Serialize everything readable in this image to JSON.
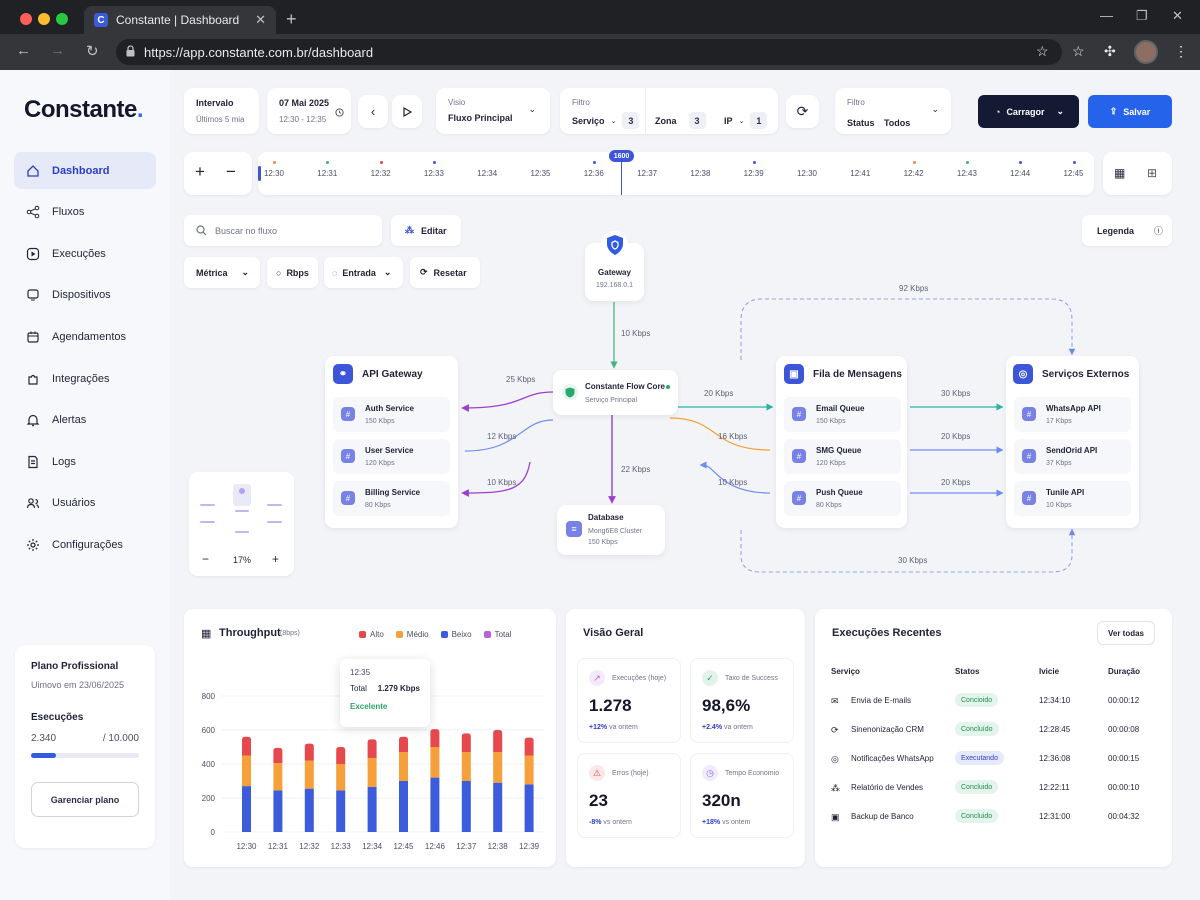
{
  "browser": {
    "tab_title": "Constante | Dashboard",
    "url": "https://app.constante.com.br/dashboard",
    "favicon": "C"
  },
  "brand": {
    "name": "Constante",
    "dot": "."
  },
  "sidebar": {
    "items": [
      {
        "label": "Dashboard",
        "icon": "home-icon"
      },
      {
        "label": "Fluxos",
        "icon": "share-icon"
      },
      {
        "label": "Execuções",
        "icon": "play-circle-icon"
      },
      {
        "label": "Dispositivos",
        "icon": "device-icon"
      },
      {
        "label": "Agendamentos",
        "icon": "calendar-icon"
      },
      {
        "label": "Integrações",
        "icon": "puzzle-icon"
      },
      {
        "label": "Alertas",
        "icon": "bell-icon"
      },
      {
        "label": "Logs",
        "icon": "file-icon"
      },
      {
        "label": "Usuários",
        "icon": "users-icon"
      },
      {
        "label": "Configurações",
        "icon": "gear-icon"
      }
    ]
  },
  "plan": {
    "title": "Plano Profissional",
    "renew": "Uimovo em 23/06/2025",
    "exec_label": "Esecuções",
    "used": "2.340",
    "total": "/ 10.000",
    "progress": 0.234,
    "button": "Garenciar plano"
  },
  "toolbar": {
    "interval_label": "Intervalo",
    "interval_value": "Últimos 5 mia",
    "date": "07 Mai 2025",
    "time_range": "12:30 - 12:35",
    "view_label": "Visio",
    "view_value": "Fluxo Principal",
    "filter_label": "Filtro",
    "servico": "Serviço",
    "servico_count": "3",
    "zona": "Zona",
    "zona_count": "3",
    "ip": "IP",
    "ip_count": "1",
    "filter2_label": "Filtro",
    "status": "Status",
    "status_value": "Todos",
    "load": "Carragor",
    "save": "Salvar"
  },
  "timeline": {
    "labels": [
      "12:30",
      "12:31",
      "12:32",
      "12:33",
      "12:34",
      "12:35",
      "12:36",
      "12:37",
      "12:38",
      "12:39",
      "12:30",
      "12:41",
      "12:42",
      "12:43",
      "12:44",
      "12:45"
    ],
    "marker": "1600",
    "dots": [
      "#f08c4a",
      "#45b46c",
      "#e5484d",
      "#3d56d9",
      "",
      "",
      "#3d56d9",
      "",
      "",
      "#3d56d9",
      "",
      "",
      "#f08c4a",
      "#45b46c",
      "#3d56d9",
      "#3d56d9"
    ]
  },
  "flow_controls": {
    "search_placeholder": "Buscar no fluxo",
    "edit": "Editar",
    "metric": "Métrica",
    "rbps": "Rbps",
    "entrada": "Entrada",
    "reset": "Resetar",
    "legend": "Legenda",
    "zoom": "17%"
  },
  "nodes": {
    "gateway": {
      "title": "Gateway",
      "ip": "192.168.0.1"
    },
    "core": {
      "title": "Constante Flow Core",
      "sub": "Serviço Principal"
    },
    "database": {
      "title": "Database",
      "sub": "Mong6E8 Cluster",
      "rate": "150 Kbps"
    },
    "api": {
      "title": "API Gateway",
      "items": [
        {
          "name": "Auth Service",
          "rate": "150 Kbps"
        },
        {
          "name": "User Service",
          "rate": "120 Kbps"
        },
        {
          "name": "Billing Service",
          "rate": "80 Kbps"
        }
      ]
    },
    "queue": {
      "title": "Fila de Mensagens",
      "items": [
        {
          "name": "Email Queue",
          "rate": "150 Kbps"
        },
        {
          "name": "SMG Queue",
          "rate": "120 Kbps"
        },
        {
          "name": "Push Queue",
          "rate": "80 Kbps"
        }
      ]
    },
    "external": {
      "title": "Serviços Externos",
      "items": [
        {
          "name": "WhatsApp API",
          "rate": "17 Kbps"
        },
        {
          "name": "SendOrid API",
          "rate": "37 Kbps"
        },
        {
          "name": "Tunile API",
          "rate": "10 Kbps"
        }
      ]
    }
  },
  "flow_labels": {
    "gw_core": "10 Kbps",
    "core_api": "25 Kbps",
    "api_core": "12 Kbps",
    "core_billing": "10 Kbps",
    "core_db": "22 Kbps",
    "core_queue": "20 Kbps",
    "core_smg": "16 Kbps",
    "push_back": "10 Kbps",
    "q_ext1": "30 Kbps",
    "q_ext2": "20 Kbps",
    "q_ext3": "20 Kbps",
    "top_loop": "92 Kbps",
    "bottom_loop": "30 Kbps"
  },
  "throughput": {
    "title": "Throughput",
    "unit": "(8bps)",
    "legend": [
      {
        "name": "Alto",
        "color": "#e5484d"
      },
      {
        "name": "Médio",
        "color": "#f5a03a"
      },
      {
        "name": "Beixo",
        "color": "#3d5cdb"
      },
      {
        "name": "Total",
        "color": "#b565d9"
      }
    ],
    "tooltip": {
      "time": "12:35",
      "label": "Total",
      "value": "1.279 Kbps",
      "status": "Excelente"
    }
  },
  "chart_data": {
    "type": "bar",
    "title": "Throughput",
    "categories": [
      "12:30",
      "12:31",
      "12:32",
      "12:33",
      "12:34",
      "12:45",
      "12:46",
      "12:37",
      "12:38",
      "12:39"
    ],
    "yticks": [
      0,
      200,
      400,
      600,
      800
    ],
    "ylim": [
      0,
      800
    ],
    "series": [
      {
        "name": "Beixo",
        "values": [
          270,
          245,
          255,
          245,
          265,
          300,
          320,
          300,
          290,
          280
        ]
      },
      {
        "name": "Médio",
        "values": [
          180,
          160,
          165,
          155,
          170,
          170,
          180,
          170,
          180,
          170
        ]
      },
      {
        "name": "Alto",
        "values": [
          110,
          90,
          100,
          100,
          110,
          90,
          105,
          110,
          130,
          105
        ]
      }
    ]
  },
  "overview": {
    "title": "Visão Geral",
    "cards": [
      {
        "label": "Execuções (hoje)",
        "value": "1.278",
        "delta": "+12%",
        "suffix": "va ontem",
        "color": "#b565d9",
        "icon": "trend-icon"
      },
      {
        "label": "Taxo de Success",
        "value": "98,6%",
        "delta": "+2.4%",
        "suffix": "va ontem",
        "color": "#2aa86b",
        "icon": "check-icon"
      },
      {
        "label": "Erros (hoje)",
        "value": "23",
        "delta": "-8%",
        "suffix": "vs ontem",
        "color": "#e5484d",
        "icon": "warning-icon"
      },
      {
        "label": "Tempo Economio",
        "value": "320n",
        "delta": "+18%",
        "suffix": "vs ontem",
        "color": "#8a6de0",
        "icon": "clock-icon"
      }
    ]
  },
  "recent": {
    "title": "Execuções Recentes",
    "see_all": "Ver todas",
    "headers": [
      "Serviço",
      "Statos",
      "Ivicie",
      "Duração"
    ],
    "rows": [
      {
        "name": "Envia de E-mails",
        "status": "Concioido",
        "start": "12:34:10",
        "dur": "00:00:12",
        "type": "ok"
      },
      {
        "name": "Sinenonização CRM",
        "status": "Concluído",
        "start": "12:28:45",
        "dur": "00:00:08",
        "type": "ok"
      },
      {
        "name": "Notificações WhatsApp",
        "status": "Executando",
        "start": "12:36:08",
        "dur": "00:00:15",
        "type": "run"
      },
      {
        "name": "Relatório de Vendes",
        "status": "Concluido",
        "start": "12:22:11",
        "dur": "00:00:10",
        "type": "ok"
      },
      {
        "name": "Backup de Banco",
        "status": "Concluido",
        "start": "12:31:00",
        "dur": "00:04:32",
        "type": "ok"
      }
    ]
  }
}
